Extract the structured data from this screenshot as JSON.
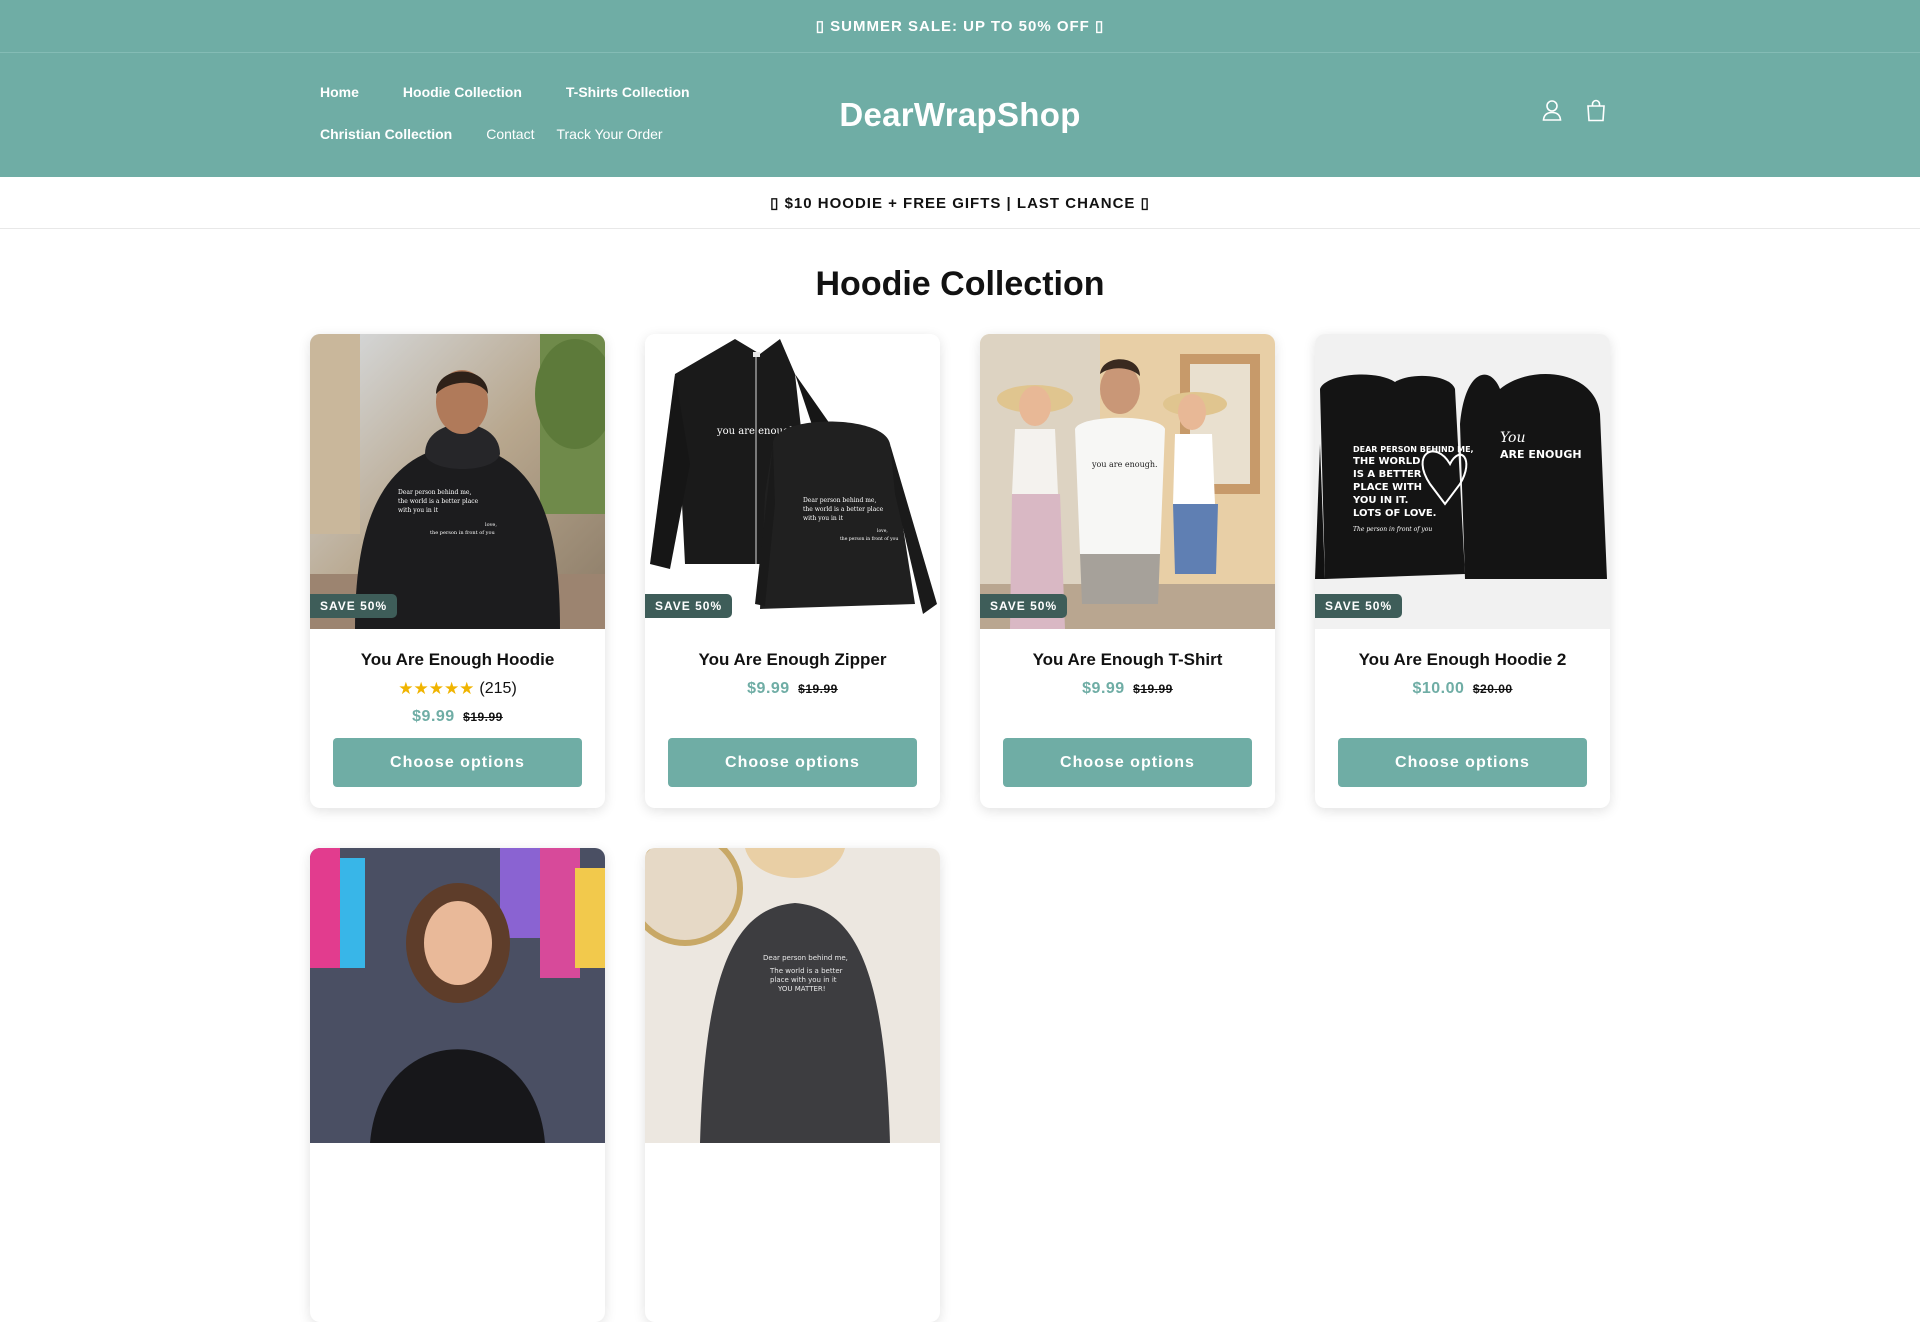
{
  "announcement": "▯ SUMMER SALE: UP TO 50% OFF ▯",
  "header": {
    "logo": "DearWrapShop",
    "nav": [
      {
        "label": "Home"
      },
      {
        "label": "Hoodie Collection"
      },
      {
        "label": "T-Shirts Collection"
      },
      {
        "label": "Christian Collection"
      },
      {
        "label": "Contact"
      },
      {
        "label": "Track Your Order"
      }
    ],
    "icons": [
      "account-icon",
      "cart-icon"
    ]
  },
  "promo": "▯ $10 HOODIE + FREE GIFTS | LAST CHANCE ▯",
  "collection": {
    "title": "Hoodie Collection",
    "products": [
      {
        "name": "You Are Enough Hoodie",
        "badge": "SAVE 50%",
        "rating_stars": "★★★★★",
        "rating_count": "(215)",
        "price": "$9.99",
        "compare_price": "$19.99",
        "button": "Choose options",
        "print": {
          "l1": "Dear person behind me,",
          "l2": "the world is a better place",
          "l3": "with you in it",
          "l4": "love,",
          "l5": "the person in front of you"
        }
      },
      {
        "name": "You Are Enough Zipper",
        "badge": "SAVE 50%",
        "price": "$9.99",
        "compare_price": "$19.99",
        "button": "Choose options",
        "print": {
          "front": "you are enough.",
          "l1": "Dear person behind me,",
          "l2": "the world is a better place",
          "l3": "with you in it",
          "l4": "love,",
          "l5": "the person in front of you"
        }
      },
      {
        "name": "You Are Enough T-Shirt",
        "badge": "SAVE 50%",
        "price": "$9.99",
        "compare_price": "$19.99",
        "button": "Choose options",
        "print": {
          "front": "you are enough."
        }
      },
      {
        "name": "You Are Enough Hoodie 2",
        "badge": "SAVE 50%",
        "price": "$10.00",
        "compare_price": "$20.00",
        "button": "Choose options",
        "print": {
          "l1": "DEAR PERSON BEHIND ME,",
          "l2": "THE WORLD",
          "l3": "IS A BETTER",
          "l4": "PLACE WITH",
          "l5": "YOU IN IT.",
          "l6": "LOTS OF LOVE.",
          "l7": "The person in front of you",
          "r1": "You",
          "r2": "ARE ENOUGH"
        }
      },
      {
        "name": "",
        "badge": ""
      },
      {
        "name": "",
        "badge": "",
        "print": {
          "l1": "Dear person behind me,",
          "l2": "The world is a better",
          "l3": "place with you in it",
          "l4": "YOU MATTER!"
        }
      }
    ]
  },
  "colors": {
    "brand": "#6fada5",
    "badge": "#3e5d59",
    "stars": "#f0b400"
  }
}
